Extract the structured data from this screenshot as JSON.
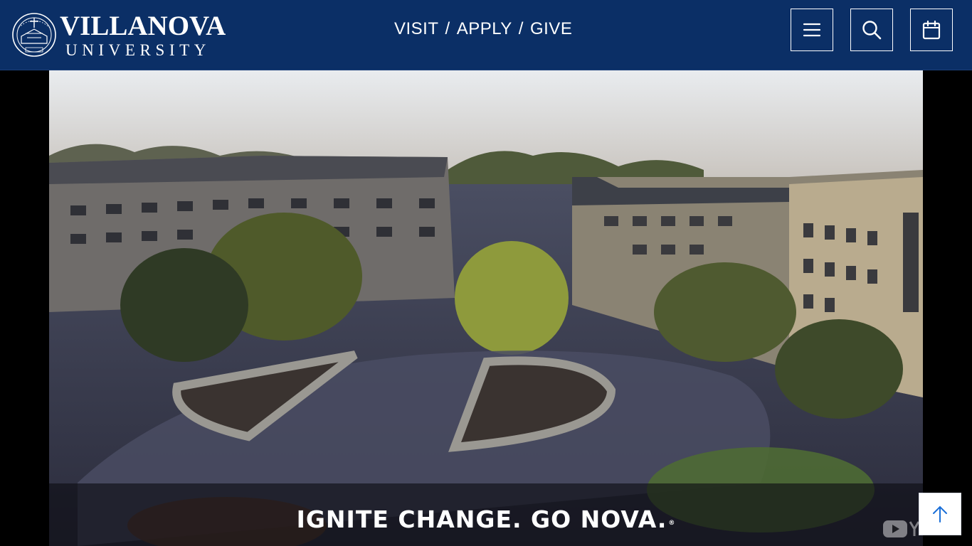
{
  "header": {
    "logo": {
      "name": "VILLANOVA",
      "sub": "UNIVERSITY",
      "seal_icon": "university-seal-icon"
    },
    "utility_links": [
      "VISIT",
      "APPLY",
      "GIVE"
    ],
    "separator": "/",
    "buttons": {
      "menu": "menu-icon",
      "search": "search-icon",
      "calendar": "calendar-icon"
    },
    "colors": {
      "background": "#0b2f66",
      "text": "#ffffff"
    }
  },
  "video": {
    "caption": "IGNITE CHANGE. GO NOVA.",
    "caption_mark": "®",
    "watermark_icon": "youtube-icon"
  },
  "back_to_top": {
    "icon": "arrow-up-icon",
    "color": "#1a6fd8"
  }
}
